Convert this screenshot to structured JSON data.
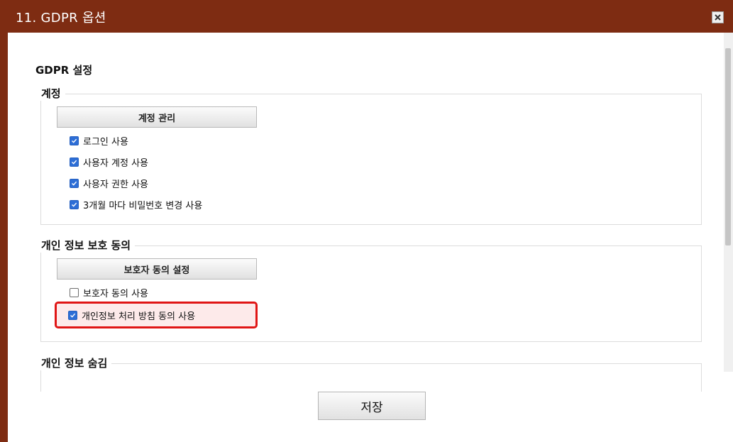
{
  "window": {
    "title": "11.  GDPR 옵션",
    "close_icon": "close-icon"
  },
  "section_title": "GDPR 설정",
  "account_group": {
    "legend": "계정",
    "manage_button": "계정 관리",
    "options": [
      {
        "label": "로그인 사용",
        "checked": true
      },
      {
        "label": "사용자 계정 사용",
        "checked": true
      },
      {
        "label": "사용자 권한 사용",
        "checked": true
      },
      {
        "label": "3개월 마다 비밀번호 변경 사용",
        "checked": true
      }
    ]
  },
  "privacy_group": {
    "legend": "개인 정보 보호 동의",
    "guardian_button": "보호자 동의 설정",
    "options": [
      {
        "label": "보호자 동의 사용",
        "checked": false
      },
      {
        "label": "개인정보 처리 방침 동의 사용",
        "checked": true,
        "highlighted": true
      }
    ]
  },
  "hide_group": {
    "legend": "개인 정보 숨김"
  },
  "footer": {
    "save_label": "저장"
  },
  "colors": {
    "title_bar": "#7e2c12",
    "checkbox_checked": "#2d6ed6",
    "highlight_border": "#e01515",
    "highlight_fill": "#fdeaea"
  }
}
